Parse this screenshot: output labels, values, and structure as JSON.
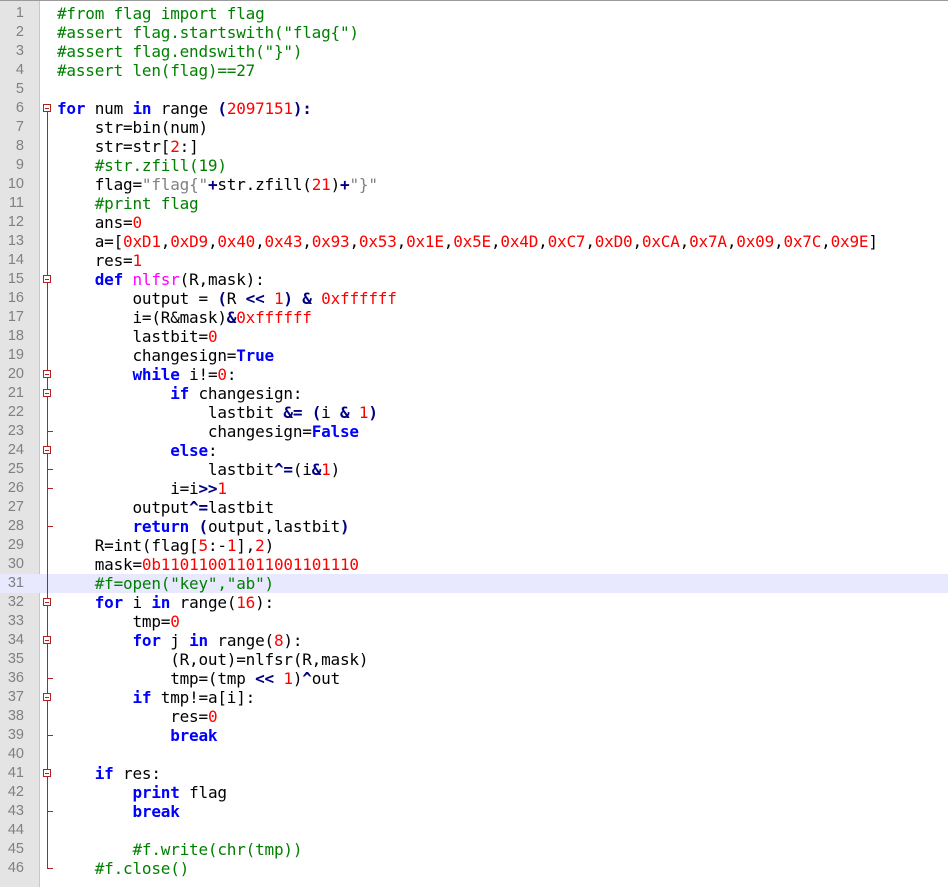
{
  "editor": {
    "current_line": 31,
    "colors": {
      "comment": "#008000",
      "keyword": "#0000ff",
      "number": "#ff0000",
      "string": "#808080",
      "operator": "#000080",
      "def_name": "#ff00ff",
      "gutter_bg": "#e4e4e4",
      "current_line_bg": "#e8e8ff",
      "fold_marker": "#b22222"
    },
    "lines": [
      {
        "n": "1",
        "fold": "none",
        "tokens": [
          {
            "c": "comment",
            "t": "#from flag import flag"
          }
        ]
      },
      {
        "n": "2",
        "fold": "none",
        "tokens": [
          {
            "c": "comment",
            "t": "#assert flag.startswith(\"flag{\")"
          }
        ]
      },
      {
        "n": "3",
        "fold": "none",
        "tokens": [
          {
            "c": "comment",
            "t": "#assert flag.endswith(\"}\")"
          }
        ]
      },
      {
        "n": "4",
        "fold": "none",
        "tokens": [
          {
            "c": "comment",
            "t": "#assert len(flag)==27"
          }
        ]
      },
      {
        "n": "5",
        "fold": "none",
        "tokens": []
      },
      {
        "n": "6",
        "fold": "open",
        "tokens": [
          {
            "c": "kw",
            "t": "for"
          },
          {
            "c": "id",
            "t": " num "
          },
          {
            "c": "kw",
            "t": "in"
          },
          {
            "c": "id",
            "t": " range "
          },
          {
            "c": "op",
            "t": "("
          },
          {
            "c": "num",
            "t": "2097151"
          },
          {
            "c": "op",
            "t": "):"
          }
        ]
      },
      {
        "n": "7",
        "fold": "line",
        "tokens": [
          {
            "c": "id",
            "t": "    str=bin(num)"
          }
        ]
      },
      {
        "n": "8",
        "fold": "line",
        "tokens": [
          {
            "c": "id",
            "t": "    str=str["
          },
          {
            "c": "num",
            "t": "2"
          },
          {
            "c": "id",
            "t": ":]"
          }
        ]
      },
      {
        "n": "9",
        "fold": "line",
        "tokens": [
          {
            "c": "comment",
            "t": "    #str.zfill(19)"
          }
        ]
      },
      {
        "n": "10",
        "fold": "line",
        "tokens": [
          {
            "c": "id",
            "t": "    flag="
          },
          {
            "c": "str",
            "t": "\"flag{\""
          },
          {
            "c": "op",
            "t": "+"
          },
          {
            "c": "id",
            "t": "str.zfill("
          },
          {
            "c": "num",
            "t": "21"
          },
          {
            "c": "id",
            "t": ")"
          },
          {
            "c": "op",
            "t": "+"
          },
          {
            "c": "str",
            "t": "\"}\""
          }
        ]
      },
      {
        "n": "11",
        "fold": "line",
        "tokens": [
          {
            "c": "comment",
            "t": "    #print flag"
          }
        ]
      },
      {
        "n": "12",
        "fold": "line",
        "tokens": [
          {
            "c": "id",
            "t": "    ans="
          },
          {
            "c": "num",
            "t": "0"
          }
        ]
      },
      {
        "n": "13",
        "fold": "line",
        "tokens": [
          {
            "c": "id",
            "t": "    a=["
          },
          {
            "c": "num",
            "t": "0xD1"
          },
          {
            "c": "id",
            "t": ","
          },
          {
            "c": "num",
            "t": "0xD9"
          },
          {
            "c": "id",
            "t": ","
          },
          {
            "c": "num",
            "t": "0x40"
          },
          {
            "c": "id",
            "t": ","
          },
          {
            "c": "num",
            "t": "0x43"
          },
          {
            "c": "id",
            "t": ","
          },
          {
            "c": "num",
            "t": "0x93"
          },
          {
            "c": "id",
            "t": ","
          },
          {
            "c": "num",
            "t": "0x53"
          },
          {
            "c": "id",
            "t": ","
          },
          {
            "c": "num",
            "t": "0x1E"
          },
          {
            "c": "id",
            "t": ","
          },
          {
            "c": "num",
            "t": "0x5E"
          },
          {
            "c": "id",
            "t": ","
          },
          {
            "c": "num",
            "t": "0x4D"
          },
          {
            "c": "id",
            "t": ","
          },
          {
            "c": "num",
            "t": "0xC7"
          },
          {
            "c": "id",
            "t": ","
          },
          {
            "c": "num",
            "t": "0xD0"
          },
          {
            "c": "id",
            "t": ","
          },
          {
            "c": "num",
            "t": "0xCA"
          },
          {
            "c": "id",
            "t": ","
          },
          {
            "c": "num",
            "t": "0x7A"
          },
          {
            "c": "id",
            "t": ","
          },
          {
            "c": "num",
            "t": "0x09"
          },
          {
            "c": "id",
            "t": ","
          },
          {
            "c": "num",
            "t": "0x7C"
          },
          {
            "c": "id",
            "t": ","
          },
          {
            "c": "num",
            "t": "0x9E"
          },
          {
            "c": "id",
            "t": "]"
          }
        ]
      },
      {
        "n": "14",
        "fold": "line",
        "tokens": [
          {
            "c": "id",
            "t": "    res="
          },
          {
            "c": "num",
            "t": "1"
          }
        ]
      },
      {
        "n": "15",
        "fold": "open-inner",
        "tokens": [
          {
            "c": "kw",
            "t": "    def"
          },
          {
            "c": "id",
            "t": " "
          },
          {
            "c": "def",
            "t": "nlfsr"
          },
          {
            "c": "id",
            "t": "(R,mask):"
          }
        ]
      },
      {
        "n": "16",
        "fold": "line",
        "tokens": [
          {
            "c": "id",
            "t": "        output = "
          },
          {
            "c": "op",
            "t": "("
          },
          {
            "c": "id",
            "t": "R "
          },
          {
            "c": "op",
            "t": "<<"
          },
          {
            "c": "id",
            "t": " "
          },
          {
            "c": "num",
            "t": "1"
          },
          {
            "c": "op",
            "t": ")"
          },
          {
            "c": "id",
            "t": " "
          },
          {
            "c": "op",
            "t": "&"
          },
          {
            "c": "id",
            "t": " "
          },
          {
            "c": "num",
            "t": "0xffffff"
          }
        ]
      },
      {
        "n": "17",
        "fold": "line",
        "tokens": [
          {
            "c": "id",
            "t": "        i=(R&mask)"
          },
          {
            "c": "op",
            "t": "&"
          },
          {
            "c": "num",
            "t": "0xffffff"
          }
        ]
      },
      {
        "n": "18",
        "fold": "line",
        "tokens": [
          {
            "c": "id",
            "t": "        lastbit="
          },
          {
            "c": "num",
            "t": "0"
          }
        ]
      },
      {
        "n": "19",
        "fold": "line",
        "tokens": [
          {
            "c": "id",
            "t": "        changesign="
          },
          {
            "c": "kw",
            "t": "True"
          }
        ]
      },
      {
        "n": "20",
        "fold": "open-inner",
        "tokens": [
          {
            "c": "kw",
            "t": "        while"
          },
          {
            "c": "id",
            "t": " i!="
          },
          {
            "c": "num",
            "t": "0"
          },
          {
            "c": "id",
            "t": ":"
          }
        ]
      },
      {
        "n": "21",
        "fold": "open-inner",
        "tokens": [
          {
            "c": "kw",
            "t": "            if"
          },
          {
            "c": "id",
            "t": " changesign:"
          }
        ]
      },
      {
        "n": "22",
        "fold": "line",
        "tokens": [
          {
            "c": "id",
            "t": "                lastbit "
          },
          {
            "c": "op",
            "t": "&="
          },
          {
            "c": "id",
            "t": " "
          },
          {
            "c": "op",
            "t": "("
          },
          {
            "c": "id",
            "t": "i "
          },
          {
            "c": "op",
            "t": "&"
          },
          {
            "c": "id",
            "t": " "
          },
          {
            "c": "num",
            "t": "1"
          },
          {
            "c": "op",
            "t": ")"
          }
        ]
      },
      {
        "n": "23",
        "fold": "end",
        "tokens": [
          {
            "c": "id",
            "t": "                changesign="
          },
          {
            "c": "kw",
            "t": "False"
          }
        ]
      },
      {
        "n": "24",
        "fold": "open-inner",
        "tokens": [
          {
            "c": "kw",
            "t": "            else"
          },
          {
            "c": "id",
            "t": ":"
          }
        ]
      },
      {
        "n": "25",
        "fold": "end",
        "tokens": [
          {
            "c": "id",
            "t": "                lastbit"
          },
          {
            "c": "op",
            "t": "^="
          },
          {
            "c": "id",
            "t": "(i"
          },
          {
            "c": "op",
            "t": "&"
          },
          {
            "c": "num",
            "t": "1"
          },
          {
            "c": "id",
            "t": ")"
          }
        ]
      },
      {
        "n": "26",
        "fold": "end",
        "tokens": [
          {
            "c": "id",
            "t": "            i=i"
          },
          {
            "c": "op",
            "t": ">>"
          },
          {
            "c": "num",
            "t": "1"
          }
        ]
      },
      {
        "n": "27",
        "fold": "line",
        "tokens": [
          {
            "c": "id",
            "t": "        output"
          },
          {
            "c": "op",
            "t": "^="
          },
          {
            "c": "id",
            "t": "lastbit"
          }
        ]
      },
      {
        "n": "28",
        "fold": "end",
        "tokens": [
          {
            "c": "kw",
            "t": "        return"
          },
          {
            "c": "id",
            "t": " "
          },
          {
            "c": "op",
            "t": "("
          },
          {
            "c": "id",
            "t": "output,lastbit"
          },
          {
            "c": "op",
            "t": ")"
          }
        ]
      },
      {
        "n": "29",
        "fold": "line",
        "tokens": [
          {
            "c": "id",
            "t": "    R=int(flag["
          },
          {
            "c": "num",
            "t": "5"
          },
          {
            "c": "id",
            "t": ":-"
          },
          {
            "c": "num",
            "t": "1"
          },
          {
            "c": "id",
            "t": "],"
          },
          {
            "c": "num",
            "t": "2"
          },
          {
            "c": "id",
            "t": ")"
          }
        ]
      },
      {
        "n": "30",
        "fold": "line",
        "tokens": [
          {
            "c": "id",
            "t": "    mask="
          },
          {
            "c": "num",
            "t": "0b110110011011001101110"
          }
        ]
      },
      {
        "n": "31",
        "fold": "line",
        "tokens": [
          {
            "c": "comment",
            "t": "    #f=open(\"key\",\"ab\")"
          }
        ]
      },
      {
        "n": "32",
        "fold": "open-inner",
        "tokens": [
          {
            "c": "kw",
            "t": "    for"
          },
          {
            "c": "id",
            "t": " i "
          },
          {
            "c": "kw",
            "t": "in"
          },
          {
            "c": "id",
            "t": " range("
          },
          {
            "c": "num",
            "t": "16"
          },
          {
            "c": "id",
            "t": "):"
          }
        ]
      },
      {
        "n": "33",
        "fold": "line",
        "tokens": [
          {
            "c": "id",
            "t": "        tmp="
          },
          {
            "c": "num",
            "t": "0"
          }
        ]
      },
      {
        "n": "34",
        "fold": "open-inner",
        "tokens": [
          {
            "c": "kw",
            "t": "        for"
          },
          {
            "c": "id",
            "t": " j "
          },
          {
            "c": "kw",
            "t": "in"
          },
          {
            "c": "id",
            "t": " range("
          },
          {
            "c": "num",
            "t": "8"
          },
          {
            "c": "id",
            "t": "):"
          }
        ]
      },
      {
        "n": "35",
        "fold": "line",
        "tokens": [
          {
            "c": "id",
            "t": "            (R,out)=nlfsr(R,mask)"
          }
        ]
      },
      {
        "n": "36",
        "fold": "end",
        "tokens": [
          {
            "c": "id",
            "t": "            tmp=(tmp "
          },
          {
            "c": "op",
            "t": "<<"
          },
          {
            "c": "id",
            "t": " "
          },
          {
            "c": "num",
            "t": "1"
          },
          {
            "c": "id",
            "t": ")"
          },
          {
            "c": "op",
            "t": "^"
          },
          {
            "c": "id",
            "t": "out"
          }
        ]
      },
      {
        "n": "37",
        "fold": "open-inner",
        "tokens": [
          {
            "c": "kw",
            "t": "        if"
          },
          {
            "c": "id",
            "t": " tmp!=a[i]:"
          }
        ]
      },
      {
        "n": "38",
        "fold": "line",
        "tokens": [
          {
            "c": "id",
            "t": "            res="
          },
          {
            "c": "num",
            "t": "0"
          }
        ]
      },
      {
        "n": "39",
        "fold": "end",
        "tokens": [
          {
            "c": "kw",
            "t": "            break"
          }
        ]
      },
      {
        "n": "40",
        "fold": "line",
        "tokens": []
      },
      {
        "n": "41",
        "fold": "open-inner",
        "tokens": [
          {
            "c": "kw",
            "t": "    if"
          },
          {
            "c": "id",
            "t": " res:"
          }
        ]
      },
      {
        "n": "42",
        "fold": "line",
        "tokens": [
          {
            "c": "kw",
            "t": "        print"
          },
          {
            "c": "id",
            "t": " flag"
          }
        ]
      },
      {
        "n": "43",
        "fold": "end",
        "tokens": [
          {
            "c": "kw",
            "t": "        break"
          }
        ]
      },
      {
        "n": "44",
        "fold": "line",
        "tokens": []
      },
      {
        "n": "45",
        "fold": "line",
        "tokens": [
          {
            "c": "comment",
            "t": "        #f.write(chr(tmp))"
          }
        ]
      },
      {
        "n": "46",
        "fold": "end",
        "tokens": [
          {
            "c": "comment",
            "t": "    #f.close()"
          }
        ]
      }
    ]
  }
}
